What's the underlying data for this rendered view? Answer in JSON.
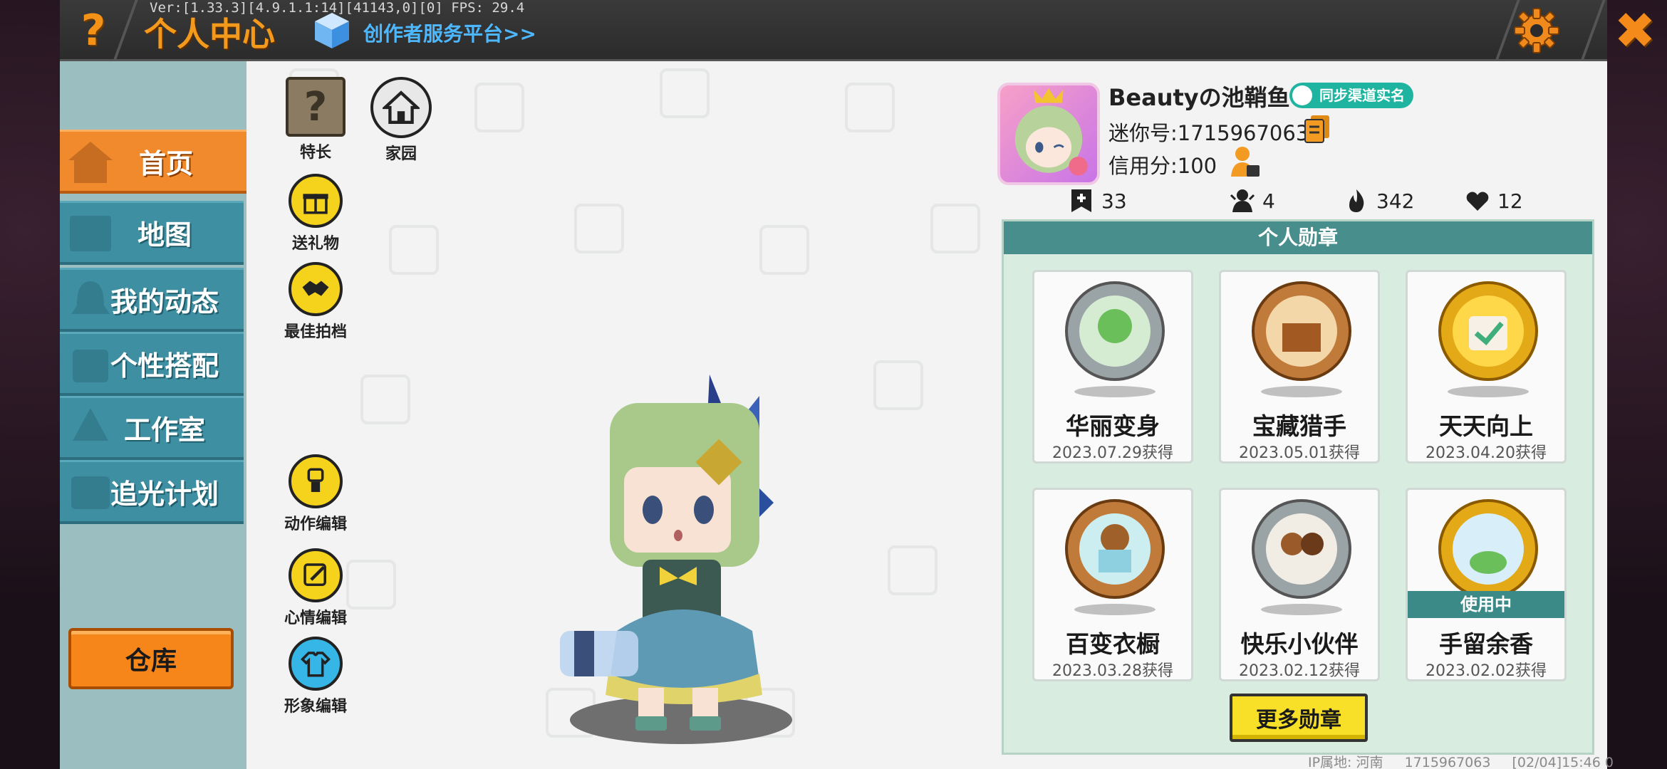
{
  "topbar": {
    "version": "Ver:[1.33.3][4.9.1.1:14][41143,0][0] FPS: 29.4",
    "help": "?",
    "title": "个人中心",
    "creator_link": "创作者服务平台>>",
    "close": "✖"
  },
  "sidebar": {
    "items": [
      {
        "label": "首页",
        "icon": "house-icon",
        "active": true
      },
      {
        "label": "地图",
        "icon": "map-icon"
      },
      {
        "label": "我的动态",
        "icon": "bell-icon"
      },
      {
        "label": "个性搭配",
        "icon": "outfit-icon"
      },
      {
        "label": "工作室",
        "icon": "tree-icon"
      },
      {
        "label": "追光计划",
        "icon": "star-icon"
      }
    ],
    "warehouse": "仓库"
  },
  "actions": {
    "specialty": "特长",
    "specialty_glyph": "?",
    "homeland": "家园",
    "send_gift": "送礼物",
    "best_photo": "最佳拍档",
    "action_edit": "动作编辑",
    "mood_edit": "心情编辑",
    "appearance_edit": "形象编辑"
  },
  "profile": {
    "username": "Beautyの池鞘鱼",
    "realname_badge": "同步渠道实名",
    "mini_id": "迷你号:1715967063",
    "credit": "信用分:100",
    "stats": [
      {
        "icon": "plus-bookmark-icon",
        "value": "33"
      },
      {
        "icon": "fans-icon",
        "value": "4"
      },
      {
        "icon": "fire-icon",
        "value": "342"
      },
      {
        "icon": "heart-icon",
        "value": "12"
      }
    ]
  },
  "medals": {
    "title": "个人勋章",
    "cards": [
      {
        "name": "华丽变身",
        "date": "2023.07.29获得",
        "color": "#9aa3a6",
        "in_use": false
      },
      {
        "name": "宝藏猎手",
        "date": "2023.05.01获得",
        "color": "#c07a3a",
        "in_use": false
      },
      {
        "name": "天天向上",
        "date": "2023.04.20获得",
        "color": "#e4a917",
        "in_use": false
      },
      {
        "name": "百变衣橱",
        "date": "2023.03.28获得",
        "color": "#c07a3a",
        "in_use": false
      },
      {
        "name": "快乐小伙伴",
        "date": "2023.02.12获得",
        "color": "#9aa3a6",
        "in_use": false
      },
      {
        "name": "手留余香",
        "date": "2023.02.02获得",
        "color": "#e4a917",
        "in_use": true,
        "in_use_label": "使用中"
      }
    ],
    "more": "更多勋章"
  },
  "footer": {
    "ip": "IP属地: 河南",
    "uid": "1715967063",
    "time": "[02/04]15:46 0"
  }
}
